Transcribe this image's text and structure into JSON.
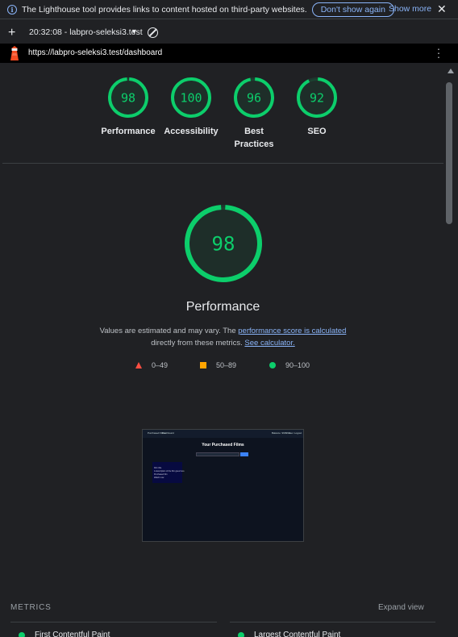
{
  "infobar": {
    "text": "The Lighthouse tool provides links to content hosted on third-party websites.",
    "dont_show": "Don't show again",
    "show_more": "Show more"
  },
  "toolbar": {
    "report": "20:32:08 - labpro-seleksi3.test"
  },
  "urlbar": {
    "url": "https://labpro-seleksi3.test/dashboard"
  },
  "colors": {
    "pass": "#0cce6b",
    "average": "#ffa400",
    "fail": "#ff4e42",
    "link": "#8ab4f8"
  },
  "gauges": [
    {
      "score": 98,
      "label": "Performance"
    },
    {
      "score": 100,
      "label": "Accessibility"
    },
    {
      "score": 96,
      "label": "Best Practices"
    },
    {
      "score": 92,
      "label": "SEO"
    }
  ],
  "performance": {
    "score": 98,
    "title": "Performance",
    "desc_1": "Values are estimated and may vary. The ",
    "desc_link": "performance score is calculated",
    "desc_2": "directly from these metrics. ",
    "calc_link": "See calculator."
  },
  "legend": {
    "fail": "0–49",
    "average": "50–89",
    "pass": "90–100"
  },
  "screenshot": {
    "nav_left": "Purchased Films",
    "nav_mid": "Dashboard",
    "nav_right": "Balance: 999999",
    "nav_user": "user",
    "nav_logout": "Logout",
    "title": "Your Purchased Films",
    "search_placeholder": "Search films",
    "search_btn": "Search",
    "card_line1": "Film title",
    "card_line2": "A description of the film goes here",
    "card_line3": "Purchased film",
    "card_line4": "Watch now"
  },
  "metrics": {
    "label": "METRICS",
    "expand": "Expand view",
    "items": [
      "First Contentful Paint",
      "Largest Contentful Paint"
    ]
  }
}
